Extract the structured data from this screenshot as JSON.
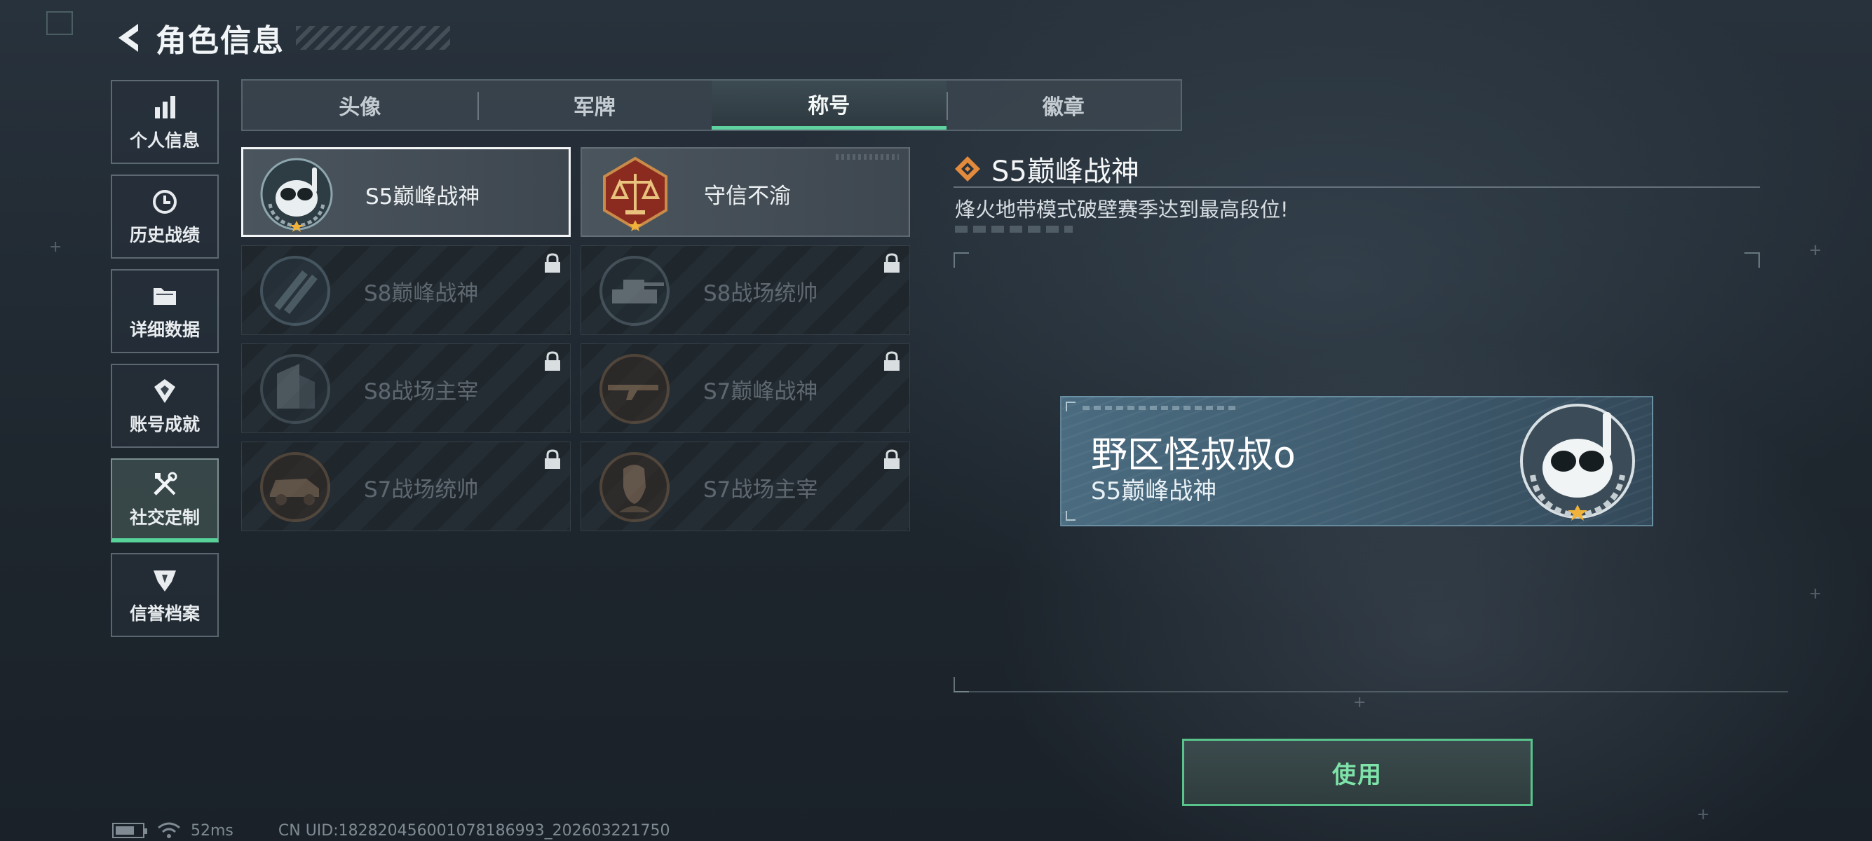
{
  "header": {
    "title": "角色信息"
  },
  "side_nav": [
    {
      "label": "个人信息",
      "icon": "bar-chart-icon"
    },
    {
      "label": "历史战绩",
      "icon": "history-clock-icon"
    },
    {
      "label": "详细数据",
      "icon": "folder-icon"
    },
    {
      "label": "账号成就",
      "icon": "achievement-icon"
    },
    {
      "label": "社交定制",
      "icon": "tools-icon",
      "active": true
    },
    {
      "label": "信誉档案",
      "icon": "reputation-icon"
    }
  ],
  "tabs": [
    {
      "label": "头像"
    },
    {
      "label": "军牌"
    },
    {
      "label": "称号",
      "active": true
    },
    {
      "label": "徽章"
    }
  ],
  "titles": [
    {
      "name": "S5巅峰战神",
      "locked": false,
      "selected": true,
      "icon": "diver-mask-badge-icon"
    },
    {
      "name": "守信不渝",
      "locked": false,
      "selected": false,
      "icon": "scales-badge-icon"
    },
    {
      "name": "S8巅峰战神",
      "locked": true,
      "icon": "slash-badge-icon"
    },
    {
      "name": "S8战场统帅",
      "locked": true,
      "icon": "tank-badge-icon"
    },
    {
      "name": "S8战场主宰",
      "locked": true,
      "icon": "building-badge-icon"
    },
    {
      "name": "S7巅峰战神",
      "locked": true,
      "icon": "rifle-badge-icon"
    },
    {
      "name": "S7战场统帅",
      "locked": true,
      "icon": "vehicle-badge-icon"
    },
    {
      "name": "S7战场主宰",
      "locked": true,
      "icon": "soldier-badge-icon"
    }
  ],
  "detail": {
    "title": "S5巅峰战神",
    "description": "烽火地带模式破壁赛季达到最高段位!"
  },
  "nameplate": {
    "player_name": "野区怪叔叔o",
    "title": "S5巅峰战神"
  },
  "use_button": {
    "label": "使用"
  },
  "status_bar": {
    "ping": "52ms",
    "uid": "CN UID:18282045600107818699​3_202603221750"
  },
  "colors": {
    "accent_green": "#5fd2a0",
    "detail_diamond": "#e48a3c",
    "gold_star": "#f0b23a"
  }
}
